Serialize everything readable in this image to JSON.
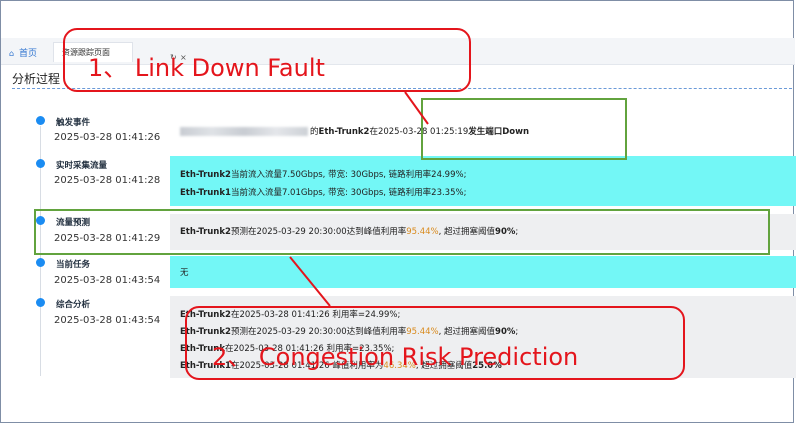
{
  "tabbar": {
    "home_label": "首页",
    "active_tab_label": "资源跟踪页面",
    "refresh_glyph": "↻",
    "close_glyph": "×"
  },
  "page": {
    "title": "分析过程"
  },
  "timeline": [
    {
      "name": "触发事件",
      "time": "2025-03-28 01:41:26",
      "style": "gray",
      "lines": [
        {
          "parts": [
            {
              "t": "的"
            },
            {
              "t": "Eth-Trunk2",
              "cls": "b"
            },
            {
              "t": "在2025-03-28 01:25:19"
            },
            {
              "t": "发生端口Down",
              "cls": "b"
            }
          ]
        }
      ]
    },
    {
      "name": "实时采集流量",
      "time": "2025-03-28 01:41:28",
      "style": "cyan",
      "lines": [
        {
          "parts": [
            {
              "t": "Eth-Trunk2",
              "cls": "b"
            },
            {
              "t": "当前流入流量7.50Gbps, 带宽: 30Gbps, 链路利用率24.99%;"
            }
          ]
        },
        {
          "parts": [
            {
              "t": "Eth-Trunk1",
              "cls": "b"
            },
            {
              "t": "当前流入流量7.01Gbps, 带宽: 30Gbps, 链路利用率23.35%;"
            }
          ]
        }
      ]
    },
    {
      "name": "流量预测",
      "time": "2025-03-28 01:41:29",
      "style": "gray",
      "lines": [
        {
          "parts": [
            {
              "t": "Eth-Trunk2",
              "cls": "b"
            },
            {
              "t": "预测在2025-03-29 20:30:00达到峰值利用率"
            },
            {
              "t": "95.44%",
              "cls": "hl"
            },
            {
              "t": ", 超过拥塞阈值"
            },
            {
              "t": "90%",
              "cls": "b"
            },
            {
              "t": ";"
            }
          ]
        }
      ]
    },
    {
      "name": "当前任务",
      "time": "2025-03-28 01:43:54",
      "style": "cyan",
      "lines": [
        {
          "parts": [
            {
              "t": "无"
            }
          ]
        }
      ]
    },
    {
      "name": "综合分析",
      "time": "2025-03-28 01:43:54",
      "style": "gray",
      "lines": [
        {
          "parts": [
            {
              "t": "Eth-Trunk2",
              "cls": "b"
            },
            {
              "t": "在2025-03-28 01:41:26 利用率=24.99%;"
            }
          ]
        },
        {
          "parts": [
            {
              "t": "Eth-Trunk2",
              "cls": "b"
            },
            {
              "t": "预测在2025-03-29 20:30:00达到峰值利用率"
            },
            {
              "t": "95.44%",
              "cls": "hl"
            },
            {
              "t": ", 超过拥塞阈值"
            },
            {
              "t": "90%",
              "cls": "b"
            },
            {
              "t": ";"
            }
          ]
        },
        {
          "parts": [
            {
              "t": "Eth-Trunk",
              "cls": "b"
            },
            {
              "t": "在2025-03-28 01:41:26 利用率=23.35%;"
            }
          ]
        },
        {
          "parts": [
            {
              "t": "Eth-Trunk1",
              "cls": "b"
            },
            {
              "t": "在2025-03-28 01:41:26 峰值利用率为"
            },
            {
              "t": "46.34%",
              "cls": "hl"
            },
            {
              "t": ", 超过拥塞阈值"
            },
            {
              "t": "25.0%",
              "cls": "b"
            }
          ]
        }
      ]
    }
  ],
  "annotations": {
    "link_down": "1、 Link Down Fault",
    "congestion": "2、 Congestion Risk Prediction"
  },
  "colors": {
    "accent_blue": "#1b8cf2",
    "cyan_row": "#73f7f6",
    "gray_row": "#eeeff1",
    "annotation_red": "#e4151c",
    "annotation_green": "#62a33e",
    "highlight_orange": "#d98a1c"
  }
}
